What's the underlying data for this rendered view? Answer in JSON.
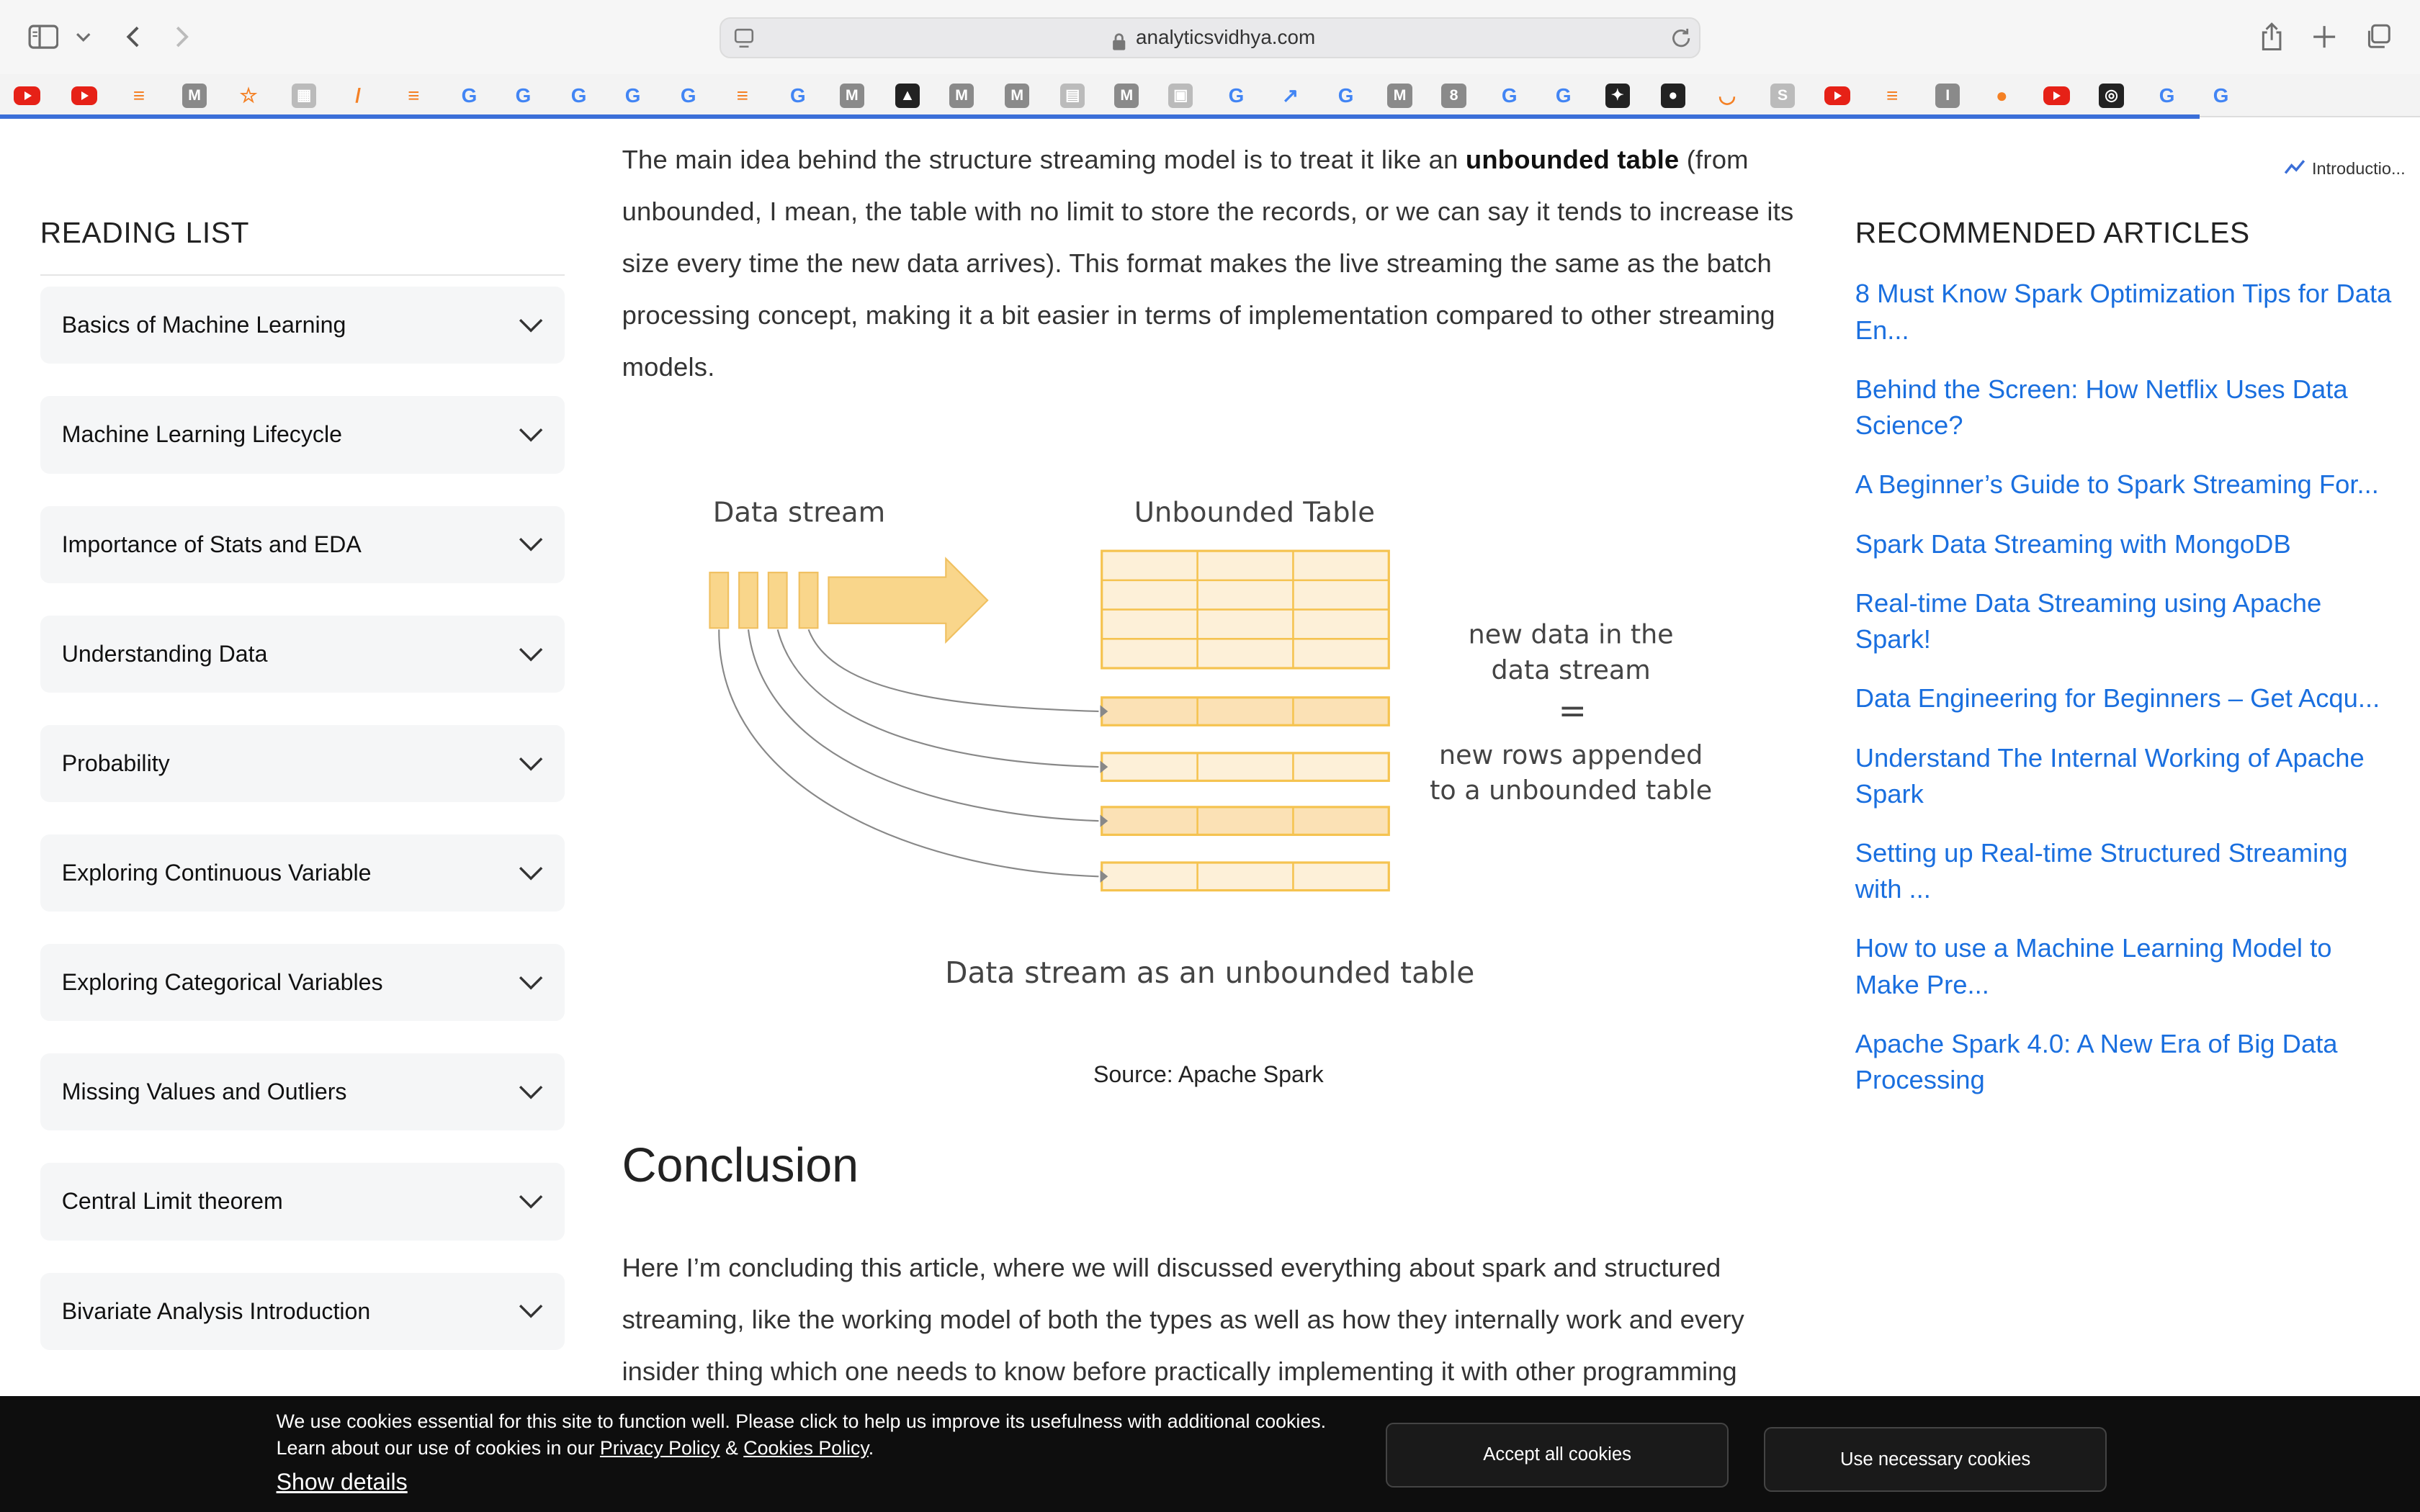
{
  "browser": {
    "url": "analyticsvidhya.com",
    "pinned_tab_title": "Introductio..."
  },
  "favorites": [
    {
      "type": "yt"
    },
    {
      "type": "yt"
    },
    {
      "type": "so",
      "glyph": "≡"
    },
    {
      "type": "m",
      "glyph": "M"
    },
    {
      "type": "so",
      "glyph": "☆"
    },
    {
      "type": "misc",
      "glyph": "▦"
    },
    {
      "type": "so",
      "glyph": "/"
    },
    {
      "type": "so",
      "glyph": "≡"
    },
    {
      "type": "g",
      "glyph": "G"
    },
    {
      "type": "g",
      "glyph": "G"
    },
    {
      "type": "g",
      "glyph": "G"
    },
    {
      "type": "g",
      "glyph": "G"
    },
    {
      "type": "g",
      "glyph": "G"
    },
    {
      "type": "so",
      "glyph": "≡"
    },
    {
      "type": "g",
      "glyph": "G"
    },
    {
      "type": "m",
      "glyph": "M"
    },
    {
      "type": "dark",
      "glyph": "▲"
    },
    {
      "type": "m",
      "glyph": "M"
    },
    {
      "type": "m",
      "glyph": "M"
    },
    {
      "type": "misc",
      "glyph": "▤"
    },
    {
      "type": "m",
      "glyph": "M"
    },
    {
      "type": "misc",
      "glyph": "▣"
    },
    {
      "type": "g",
      "glyph": "G"
    },
    {
      "type": "g",
      "glyph": "↗"
    },
    {
      "type": "g",
      "glyph": "G"
    },
    {
      "type": "m",
      "glyph": "M"
    },
    {
      "type": "m",
      "glyph": "8"
    },
    {
      "type": "g",
      "glyph": "G"
    },
    {
      "type": "g",
      "glyph": "G"
    },
    {
      "type": "dark",
      "glyph": "✦"
    },
    {
      "type": "dark",
      "glyph": "●"
    },
    {
      "type": "so",
      "glyph": "◡"
    },
    {
      "type": "misc",
      "glyph": "S"
    },
    {
      "type": "yt"
    },
    {
      "type": "so",
      "glyph": "≡"
    },
    {
      "type": "m",
      "glyph": "I"
    },
    {
      "type": "so",
      "glyph": "●"
    },
    {
      "type": "yt"
    },
    {
      "type": "dark",
      "glyph": "◎"
    },
    {
      "type": "g",
      "glyph": "G"
    },
    {
      "type": "g",
      "glyph": "G"
    }
  ],
  "reading_list": {
    "title": "READING LIST",
    "items": [
      "Basics of Machine Learning",
      "Machine Learning Lifecycle",
      "Importance of Stats and EDA",
      "Understanding Data",
      "Probability",
      "Exploring Continuous Variable",
      "Exploring Categorical Variables",
      "Missing Values and Outliers",
      "Central Limit theorem",
      "Bivariate Analysis Introduction"
    ]
  },
  "article": {
    "para1_a": "The main idea behind the structure streaming model is to treat it like an ",
    "para1_bold": "unbounded table",
    "para1_b": " (from unbounded, I mean, the table with no limit to store the records, or we can say it tends to increase its size every time the new data arrives). This format makes the live streaming the same as the batch processing concept, making it a bit easier in terms of implementation compared to other streaming models.",
    "figure": {
      "label_stream": "Data stream",
      "label_table": "Unbounded Table",
      "note_line1": "new data in the",
      "note_line2": "data stream",
      "note_eq": "=",
      "note_line3": "new rows appended",
      "note_line4": "to a unbounded table",
      "caption": "Data stream as an unbounded table"
    },
    "source": "Source: Apache Spark",
    "conclusion_heading": "Conclusion",
    "para2": "Here I’m concluding this article, where we will discussed everything about spark and structured streaming, like the working model of both the types as well as how they internally work and every insider thing which one needs to know before practically implementing it with other programming"
  },
  "recommended": {
    "title": "RECOMMENDED ARTICLES",
    "items": [
      "8 Must Know Spark Optimization Tips for Data En...",
      "Behind the Screen: How Netflix Uses Data Science?",
      "A Beginner’s Guide to Spark Streaming For...",
      "Spark Data Streaming with MongoDB",
      "Real-time Data Streaming using Apache Spark!",
      "Data Engineering for Beginners – Get Acqu...",
      "Understand The Internal Working of Apache Spark",
      "Setting up Real-time Structured Streaming with ...",
      "How to use a Machine Learning Model to Make Pre...",
      "Apache Spark 4.0: A New Era of Big Data Processing"
    ]
  },
  "cookie": {
    "msg_a": "We use cookies essential for this site to function well. Please click to help us improve its usefulness with additional cookies. Learn about our use of cookies in our ",
    "privacy": "Privacy Policy",
    "amp": " & ",
    "cookies_policy": "Cookies Policy",
    "period": ".",
    "details": "Show details",
    "accept": "Accept all cookies",
    "necessary": "Use necessary cookies"
  }
}
